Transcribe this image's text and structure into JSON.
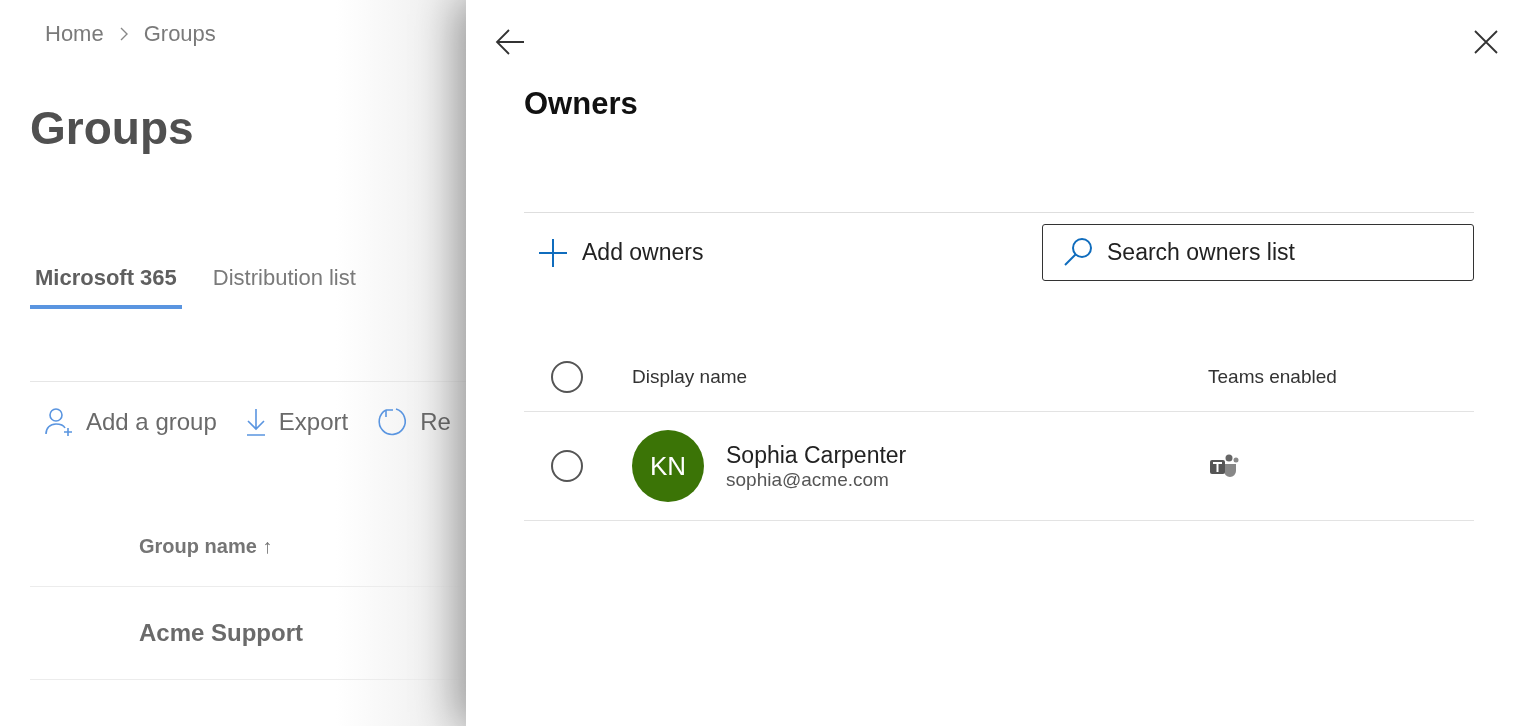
{
  "background_page": {
    "breadcrumb": [
      "Home",
      "Groups"
    ],
    "title": "Groups",
    "tabs": [
      {
        "label": "Microsoft 365",
        "selected": true
      },
      {
        "label": "Distribution list",
        "selected": false
      }
    ],
    "toolbar": [
      {
        "kind": "add-person",
        "label": "Add a group"
      },
      {
        "kind": "download",
        "label": "Export"
      },
      {
        "kind": "refresh",
        "label": "Re"
      }
    ],
    "table": {
      "columns": [
        "Group name ↑"
      ],
      "rows": [
        [
          "Acme Support"
        ]
      ]
    }
  },
  "panel": {
    "title": "Owners",
    "add_button": "Add owners",
    "search": {
      "placeholder": "Search owners list"
    },
    "table": {
      "columns": [
        "Display name",
        "Teams enabled"
      ],
      "header_checkbox": {
        "selected": false
      },
      "rows": [
        {
          "selected": false,
          "initials": "KN",
          "name": "Sophia Carpenter",
          "email": "sophia@acme.com",
          "teams_enabled": true
        }
      ]
    }
  }
}
